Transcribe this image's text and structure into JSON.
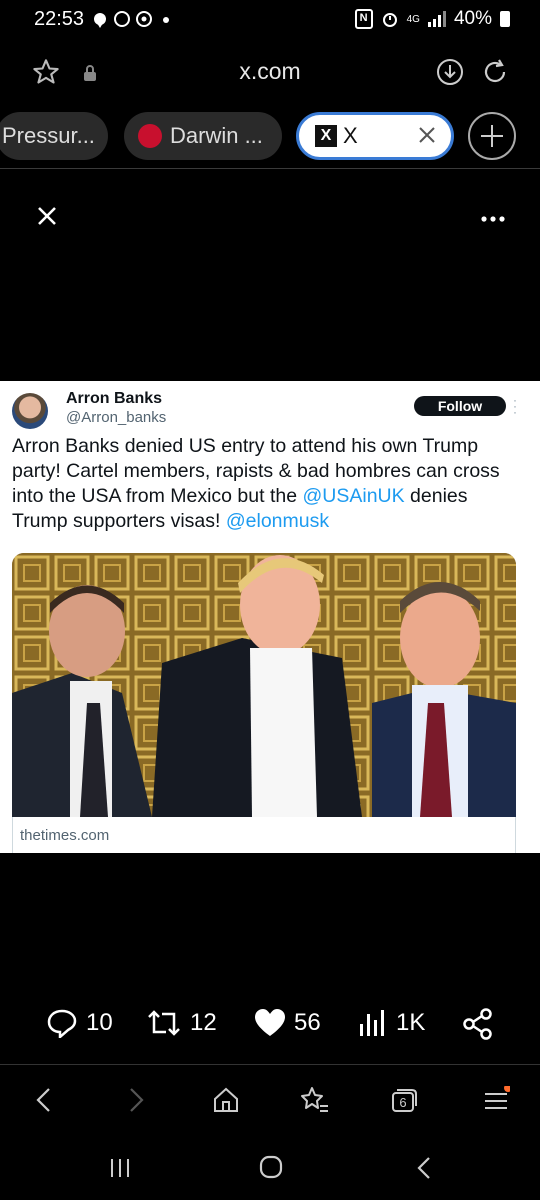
{
  "status": {
    "time": "22:53",
    "network": "4G",
    "battery": "40%"
  },
  "browser": {
    "url": "x.com",
    "tabs": [
      {
        "label": "Pressur..."
      },
      {
        "label": "Darwin ..."
      },
      {
        "label": "X"
      }
    ],
    "tab_count": "6"
  },
  "tweet": {
    "author_name": "Arron Banks",
    "author_handle": "@Arron_banks",
    "follow_label": "Follow",
    "text_part1": "Arron Banks denied US entry to attend his own Trump party! Cartel members, rapists & bad hombres can cross into the USA from Mexico but the ",
    "mention1": "@USAinUK",
    "text_part2": " denies Trump supporters visas! ",
    "mention2": "@elonmusk",
    "link_domain": "thetimes.com"
  },
  "actions": {
    "replies": "10",
    "reposts": "12",
    "likes": "56",
    "views": "1K"
  },
  "colors": {
    "accent": "#1d9bf0",
    "tab_active_border": "#3a7bd5",
    "notification_dot": "#ff6b2c"
  },
  "icons": [
    "star-icon",
    "lock-icon",
    "download-icon",
    "refresh-icon",
    "close-icon",
    "more-icon",
    "reply-icon",
    "repost-icon",
    "like-icon",
    "views-icon",
    "share-icon",
    "back-icon",
    "forward-icon",
    "home-icon",
    "bookmarks-icon",
    "tabs-icon",
    "menu-icon"
  ]
}
